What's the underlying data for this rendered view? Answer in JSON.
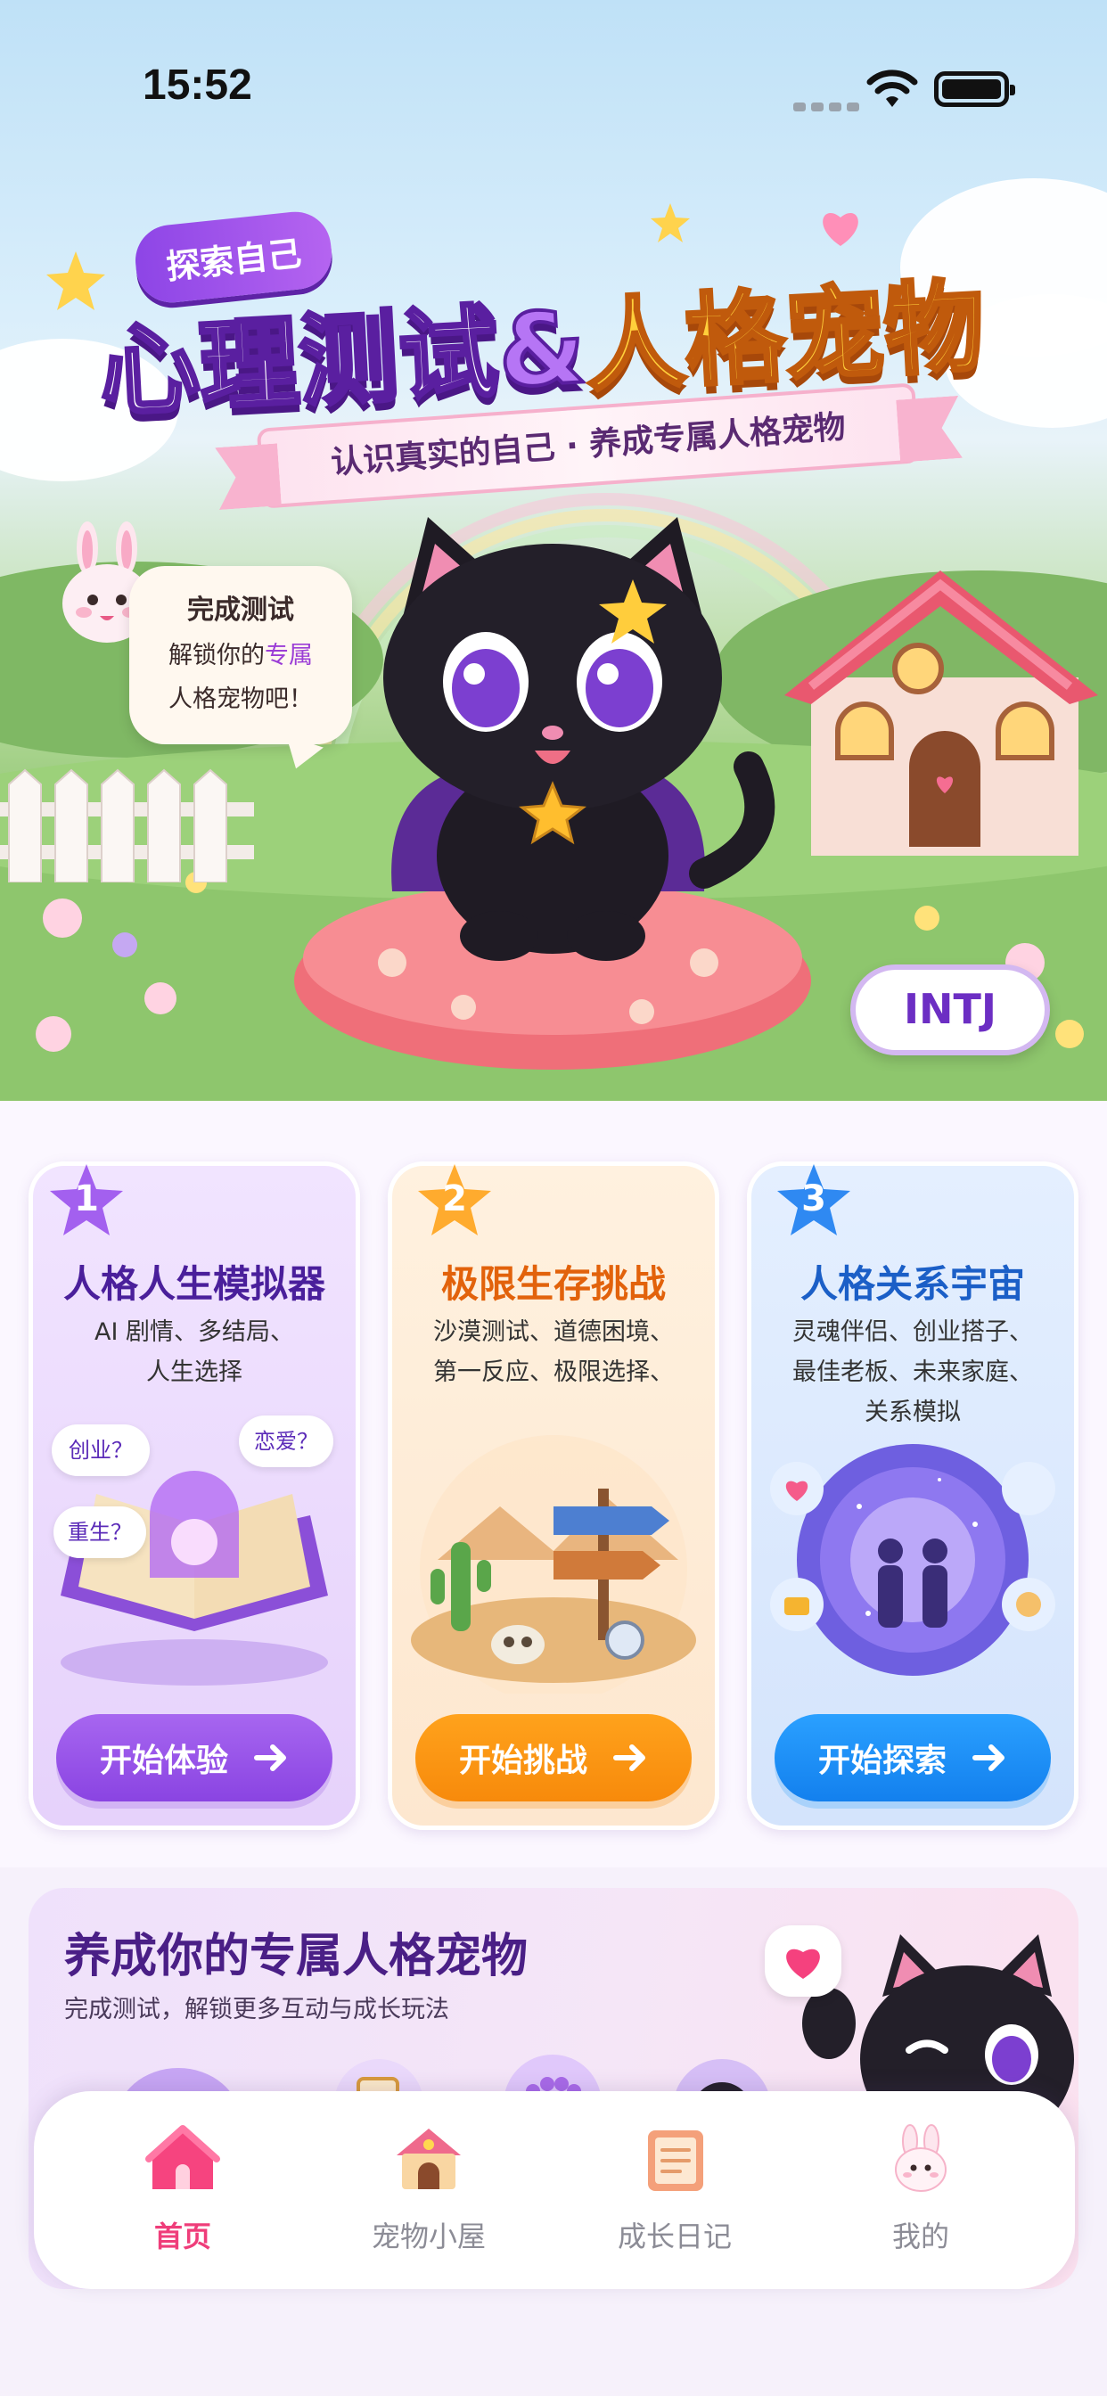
{
  "status_bar": {
    "time": "15:52"
  },
  "hero": {
    "tag": "探索自己",
    "title_part1": "心理测试",
    "title_amp": "&",
    "title_part2": "人格宠物",
    "ribbon": "认识真实的自己 · 养成专属人格宠物",
    "bubble": {
      "line1": "完成测试",
      "line2_prefix": "解锁你的",
      "line2_highlight": "专属",
      "line3": "人格宠物吧！"
    },
    "personality_badge": "INTJ"
  },
  "features": [
    {
      "index": "1",
      "title": "人格人生模拟器",
      "desc_lines": [
        "AI 剧情、多结局、",
        "人生选择"
      ],
      "tags": [
        "创业？",
        "恋爱？",
        "重生？"
      ],
      "button": "开始体验",
      "color": "#5b2bb8"
    },
    {
      "index": "2",
      "title": "极限生存挑战",
      "desc_lines": [
        "沙漠测试、道德困境、",
        "第一反应、极限选择、"
      ],
      "button": "开始挑战",
      "color": "#e26a10"
    },
    {
      "index": "3",
      "title": "人格关系宇宙",
      "desc_lines": [
        "灵魂伴侣、创业搭子、",
        "最佳老板、未来家庭、",
        "关系模拟"
      ],
      "button": "开始探索",
      "color": "#1c63c9"
    }
  ],
  "pet_banner": {
    "title": "养成你的专属人格宠物",
    "subtitle": "完成测试，解锁更多互动与成长玩法"
  },
  "tabbar": [
    {
      "label": "首页",
      "icon": "home-icon",
      "active": true
    },
    {
      "label": "宠物小屋",
      "icon": "pet-house-icon",
      "active": false
    },
    {
      "label": "成长日记",
      "icon": "diary-icon",
      "active": false
    },
    {
      "label": "我的",
      "icon": "bunny-profile-icon",
      "active": false
    }
  ],
  "colors": {
    "accent_pink": "#ef3d7a",
    "purple": "#8a44e2",
    "orange": "#f78a0b",
    "blue": "#1380ee"
  }
}
